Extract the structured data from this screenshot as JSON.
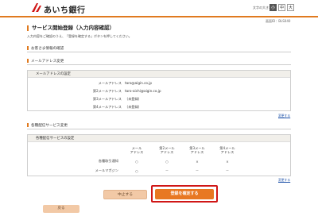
{
  "header": {
    "bank_name": "あいち銀行",
    "font_size_label": "文字の大きさ",
    "font_sizes": [
      "小",
      "中",
      "大"
    ]
  },
  "screen_id": "画面ID：BLS040",
  "page": {
    "title": "サービス開始登録（入力内容確認）",
    "intro": "入力内容をご確認のうえ、「登録を確定する」ボタンを押してください。"
  },
  "customer_info": {
    "section_title": "お客さま情報の確認"
  },
  "email_section": {
    "section_title": "メールアドレス変更",
    "box_title": "メールアドレスの設定",
    "rows": [
      {
        "label": "メールアドレス",
        "value": "taro@aigin.co.jp"
      },
      {
        "label": "第2メールアドレス",
        "value": "taro-aichi@aigin.co.jp"
      },
      {
        "label": "第3メールアドレス",
        "value": "（未登録）"
      },
      {
        "label": "第4メールアドレス",
        "value": "（未登録）"
      }
    ],
    "change_link": "変更する"
  },
  "notify_section": {
    "section_title": "各種配信サービス変更",
    "box_title": "各種配信サービスの設定",
    "columns": [
      "メール\nアドレス",
      "第2メール\nアドレス",
      "第3メール\nアドレス",
      "第4メール\nアドレス"
    ],
    "rows": [
      {
        "label": "各種取引通知",
        "cells": [
          "○",
          "○",
          "×",
          "×"
        ]
      },
      {
        "label": "メールマガジン",
        "cells": [
          "○",
          "－",
          "－",
          "－"
        ]
      }
    ],
    "change_link": "変更する"
  },
  "buttons": {
    "cancel": "中止する",
    "confirm": "登録を確定する",
    "back": "戻る"
  },
  "colors": {
    "accent": "#e07a1f",
    "highlight": "#d01616"
  }
}
